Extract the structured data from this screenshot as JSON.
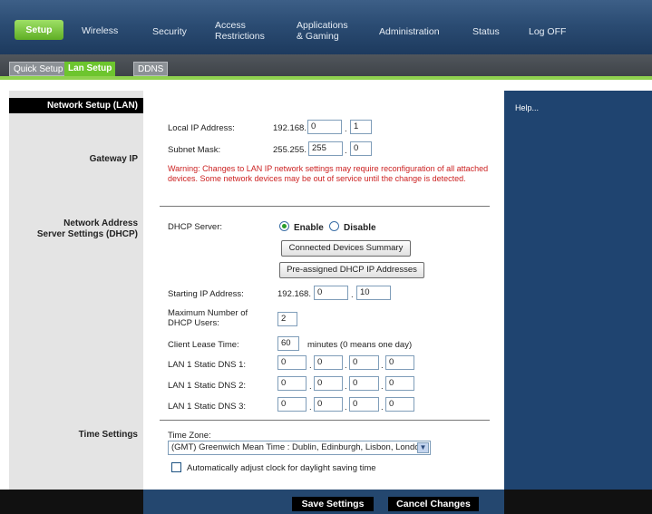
{
  "nav": {
    "tabs": [
      "Setup",
      "Wireless",
      "Security",
      "Access\nRestrictions",
      "Applications\n& Gaming",
      "Administration",
      "Status",
      "Log OFF"
    ],
    "active_tab": "Setup"
  },
  "subnav": {
    "tabs": [
      "Quick Setup",
      "Lan Setup",
      "DDNS"
    ],
    "active_tab": "Lan Setup"
  },
  "left": {
    "header": "Network Setup (LAN)",
    "gateway_ip": "Gateway IP",
    "network_address_1": "Network Address",
    "network_address_2": "Server Settings (DHCP)",
    "time_settings": "Time Settings"
  },
  "help": {
    "label": "Help..."
  },
  "gateway": {
    "local_ip_label": "Local IP Address:",
    "local_ip_prefix": "192.168.",
    "local_ip_octet3": "0",
    "local_ip_octet4": "1",
    "subnet_label": "Subnet Mask:",
    "subnet_prefix": "255.255.",
    "subnet_octet3": "255",
    "subnet_octet4": "0",
    "warning": "Warning: Changes to LAN IP network settings may require reconfiguration of all attached devices. Some network devices may be out of service until the change is detected."
  },
  "dhcp": {
    "server_label": "DHCP Server:",
    "enable_label": "Enable",
    "disable_label": "Disable",
    "enabled": true,
    "connected_btn": "Connected Devices Summary",
    "preassigned_btn": "Pre-assigned DHCP IP Addresses",
    "start_ip_label": "Starting IP Address:",
    "start_ip_prefix": "192.168.",
    "start_ip_octet3": "0",
    "start_ip_octet4": "10",
    "max_users_label_1": "Maximum Number of",
    "max_users_label_2": "DHCP Users:",
    "max_users": "2",
    "lease_label": "Client Lease Time:",
    "lease_value": "60",
    "lease_unit": "minutes (0 means one day)",
    "dns1_label": "LAN 1 Static DNS 1:",
    "dns2_label": "LAN 1 Static DNS 2:",
    "dns3_label": "LAN 1 Static DNS 3:",
    "dns1": [
      "0",
      "0",
      "0",
      "0"
    ],
    "dns2": [
      "0",
      "0",
      "0",
      "0"
    ],
    "dns3": [
      "0",
      "0",
      "0",
      "0"
    ]
  },
  "time": {
    "zone_label": "Time Zone:",
    "zone_value": "(GMT) Greenwich Mean Time : Dublin, Edinburgh, Lisbon, London",
    "dst_label": "Automatically adjust clock for daylight saving time",
    "dst_checked": false
  },
  "actions": {
    "save": "Save Settings",
    "cancel": "Cancel Changes"
  },
  "colors": {
    "accent_green": "#6dc52e",
    "nav_blue": "#2b4c73",
    "warning_red": "#cc2222"
  }
}
